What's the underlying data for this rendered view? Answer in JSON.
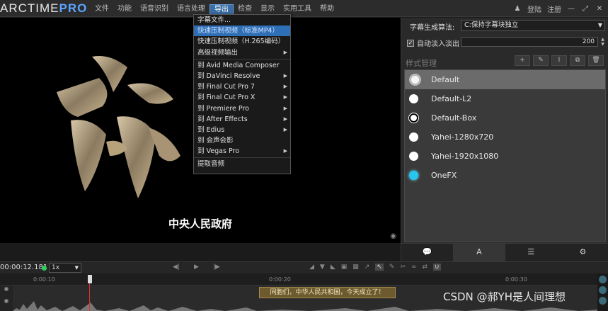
{
  "app": {
    "logo_main": "ARCTIME",
    "logo_pro": "PRO"
  },
  "menu": {
    "items": [
      "文件",
      "功能",
      "语音识别",
      "语言处理",
      "导出",
      "检查",
      "显示",
      "实用工具",
      "帮助"
    ],
    "active_index": 4,
    "right": {
      "user_icon": "user-icon",
      "login": "登陆",
      "register": "注册"
    }
  },
  "export_menu": {
    "items": [
      {
        "label": "字幕文件...",
        "submenu": false
      },
      {
        "label": "快速压制视频（标准MP4）",
        "submenu": false,
        "highlighted": true
      },
      {
        "label": "快速压制视频（H.265编码）",
        "submenu": false
      },
      {
        "label": "高级视频输出",
        "submenu": true
      },
      {
        "label": "到 Avid Media Composer",
        "submenu": false
      },
      {
        "label": "到 DaVinci Resolve",
        "submenu": true
      },
      {
        "label": "到 Final Cut Pro 7",
        "submenu": true
      },
      {
        "label": "到 Final Cut Pro X",
        "submenu": true
      },
      {
        "label": "到 Premiere Pro",
        "submenu": true
      },
      {
        "label": "到 After Effects",
        "submenu": true
      },
      {
        "label": "到 Edius",
        "submenu": true
      },
      {
        "label": "到 会声会影",
        "submenu": false
      },
      {
        "label": "到 Vegas Pro",
        "submenu": true
      },
      {
        "label": "提取音频",
        "submenu": false
      }
    ]
  },
  "video": {
    "subtitle": "中央人民政府"
  },
  "right_panel": {
    "algo_label": "字幕生成算法:",
    "algo_value": "C:保持字幕块独立",
    "fade_label": "自动淡入淡出",
    "fade_checked": true,
    "fade_value": "200",
    "style_header": "样式管理",
    "style_tools": [
      "+",
      "✎",
      "I",
      "⧉",
      "🗑"
    ],
    "styles": [
      {
        "name": "Default",
        "swatch": "ring",
        "selected": true
      },
      {
        "name": "Default-L2",
        "swatch": "white"
      },
      {
        "name": "Default-Box",
        "swatch": "box"
      },
      {
        "name": "Yahei-1280x720",
        "swatch": "white"
      },
      {
        "name": "Yahei-1920x1080",
        "swatch": "white"
      },
      {
        "name": "OneFX",
        "swatch": "cyan"
      }
    ],
    "tabs": [
      "💬",
      "A",
      "☰",
      "⚙"
    ]
  },
  "timeline": {
    "time": "00:00:12.181",
    "speed": "1x",
    "ticks": [
      "0:00:10",
      "0:00:20",
      "0:00:30"
    ],
    "subtitle_block": "同胞们，中华人民共和国，今天成立了！"
  },
  "watermark": "CSDN @郝YH是人间理想"
}
